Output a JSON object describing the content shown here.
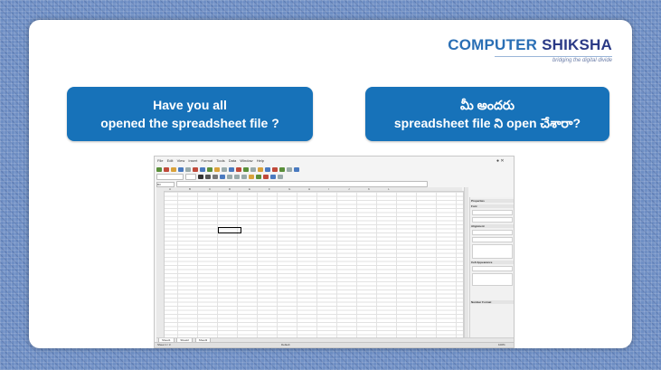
{
  "logo": {
    "brand_part1": "COMPUTER",
    "brand_part2": "SHIKSHA",
    "tagline": "bridging the digital divide"
  },
  "question_english": {
    "line1": "Have you all",
    "line2": "opened the spreadsheet file ?"
  },
  "question_telugu": {
    "line1": "మీ అందరు",
    "line2": "spreadsheet file ని open చేశారా?"
  },
  "app_screenshot": {
    "menu_items": [
      "File",
      "Edit",
      "View",
      "Insert",
      "Format",
      "Tools",
      "Data",
      "Window",
      "Help"
    ],
    "cell_ref": "B3",
    "columns": [
      "A",
      "B",
      "C",
      "D",
      "E",
      "F",
      "G",
      "H",
      "I",
      "J",
      "K",
      "L"
    ],
    "sidebar_title": "Properties",
    "sidebar_sections": [
      "Font",
      "Alignment",
      "Cell Appearance",
      "Number Format"
    ],
    "sheet_tabs": [
      "Sheet1",
      "Sheet2",
      "Sheet3"
    ],
    "status_left": "Sheet 1 / 3",
    "status_mid": "Default",
    "status_right": "100%"
  },
  "colors": {
    "bubble": "#1772b9",
    "logo_blue": "#2a6fb5",
    "logo_navy": "#2b3a86",
    "background": "#6f8fc4"
  }
}
